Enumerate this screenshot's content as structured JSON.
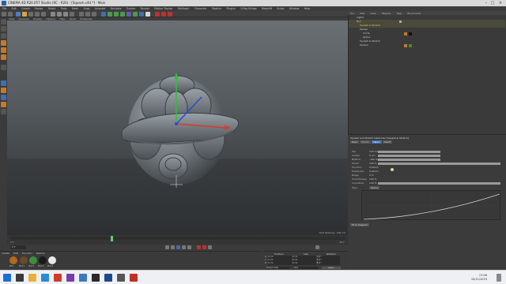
{
  "titlebar": {
    "title": "CINEMA 4D R20.057 Studio (RC - R20) - [Squash.c4d *] - Main"
  },
  "menubar": {
    "items": [
      "File",
      "Edit",
      "Create",
      "Modes",
      "Select",
      "Tools",
      "Mesh",
      "Snap",
      "Animate",
      "Simulate",
      "Tracker",
      "Render",
      "Motion Tracker",
      "MoGraph",
      "Character",
      "Pipeline",
      "Plugins",
      "V-Ray Bridge",
      "Redshift",
      "Script",
      "Window",
      "Help"
    ]
  },
  "viewport": {
    "header": [
      "View",
      "Cameras",
      "Display",
      "Options",
      "Filter",
      "Panel",
      "ProRender"
    ],
    "grid_spacing": "Grid Spacing : 100 cm"
  },
  "object_manager": {
    "tabs": [
      "File",
      "Edit",
      "View",
      "Objects",
      "Tags",
      "Bookmarks"
    ],
    "items": [
      {
        "name": "Lights"
      },
      {
        "name": "Null"
      },
      {
        "name": "Squash & Stretch"
      },
      {
        "name": "Sweep"
      },
      {
        "name": "Circle"
      },
      {
        "name": "Spline"
      },
      {
        "name": "Squash & Stretch"
      },
      {
        "name": "Sphere"
      }
    ]
  },
  "attributes": {
    "header": "Squash and Stretch Deformer [Squash & Stretch]",
    "tabs": [
      "Basic",
      "Coord.",
      "Object",
      "Falloff"
    ],
    "rows": [
      {
        "label": "Top",
        "value": "100 cm"
      },
      {
        "label": "Center",
        "value": "0 cm"
      },
      {
        "label": "Bottom",
        "value": "-100 cm"
      },
      {
        "label": "Factor",
        "value": "100 %"
      },
      {
        "label": "Function",
        "value": "Custom"
      },
      {
        "label": "Expansion",
        "value": "Custom"
      },
      {
        "label": "Bulge",
        "value": "0 %"
      },
      {
        "label": "Smoothness",
        "value": "100 %"
      },
      {
        "label": "Curvature",
        "value": "100 %"
      },
      {
        "label": "Type",
        "value": "Spline"
      }
    ],
    "footer": "Fit to Diagram"
  },
  "materials": {
    "menu": [
      "Create",
      "Edit",
      "Function",
      "Texture"
    ],
    "items": [
      "Mat",
      "Mat.1",
      "Mat.2",
      "Mat.3",
      "Mat.4"
    ],
    "colors": [
      "#b06a1a",
      "#6b4a2a",
      "#3f8f3a",
      "#1a1a1a",
      "#e8e8e8"
    ]
  },
  "coords": {
    "headers": [
      "Position",
      "Size",
      "Rotation"
    ],
    "rows": [
      [
        "X",
        "0 cm",
        "0 cm",
        "H",
        "0 °"
      ],
      [
        "Y",
        "0 cm",
        "0 cm",
        "P",
        "0 °"
      ],
      [
        "Z",
        "0 cm",
        "0 cm",
        "B",
        "0 °"
      ]
    ],
    "mode": "Object (Rel)",
    "size_mode": "Size",
    "apply": "Apply"
  },
  "timeline": {
    "start": "0 F",
    "end": "90 F",
    "current": "0 F"
  },
  "taskbar": {
    "time": "17:06",
    "date": "10/11/2019"
  }
}
